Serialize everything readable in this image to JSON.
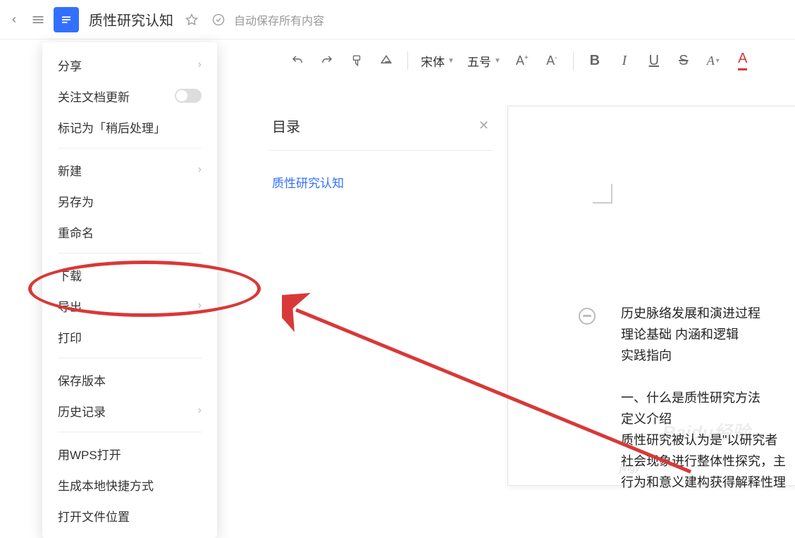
{
  "topbar": {
    "doc_title": "质性研究认知",
    "autosave": "自动保存所有内容"
  },
  "toolbar": {
    "font_name": "宋体",
    "font_size": "五号",
    "increase_font": "A⁺",
    "decrease_font": "A⁻",
    "bold": "B",
    "italic": "I",
    "underline": "U",
    "strike": "S",
    "font_style_a": "A",
    "font_color_a": "A"
  },
  "menu": {
    "share": "分享",
    "follow_updates": "关注文档更新",
    "mark_later": "标记为「稍后处理」",
    "new": "新建",
    "save_as": "另存为",
    "rename": "重命名",
    "download": "下载",
    "export": "导出",
    "print": "打印",
    "save_version": "保存版本",
    "history": "历史记录",
    "open_wps": "用WPS打开",
    "create_shortcut": "生成本地快捷方式",
    "open_location": "打开文件位置"
  },
  "outline": {
    "title": "目录",
    "link": "质性研究认知"
  },
  "doc": {
    "l1": "历史脉络发展和演进过程",
    "l2": "理论基础 内涵和逻辑",
    "l3": "实践指向",
    "l4": "一、什么是质性研究方法",
    "l5": "定义介绍",
    "l6": "质性研究被认为是\"以研究者",
    "l7": "社会现象进行整体性探究，主",
    "l8": "行为和意义建构获得解释性理"
  },
  "watermark": {
    "main": "Baidu经验",
    "sub": "jingy"
  }
}
